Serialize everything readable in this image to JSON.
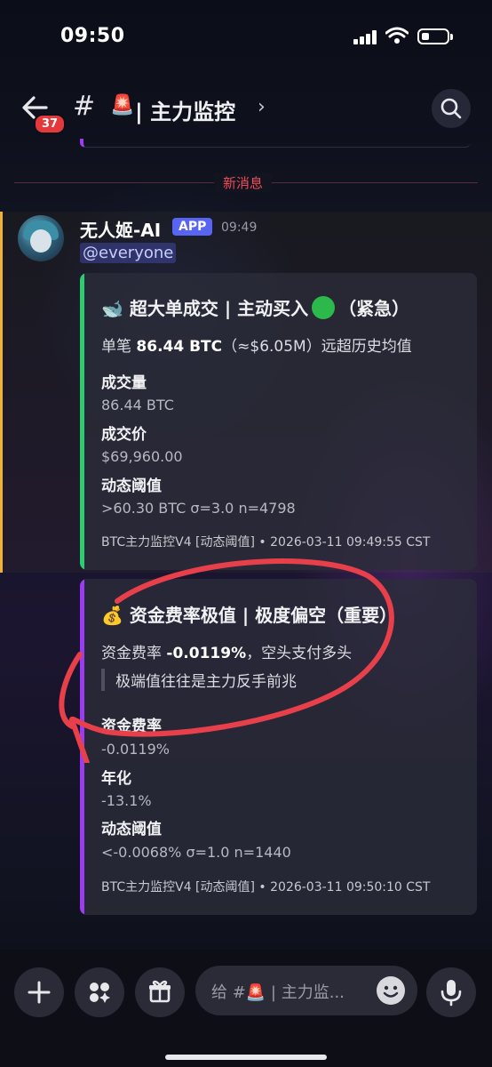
{
  "status_bar": {
    "time": "09:50"
  },
  "header": {
    "back_badge": "37",
    "hash": "#",
    "channel_emoji": "🚨",
    "channel_name": "| 主力监控",
    "chevron": "›",
    "icons": [
      "back-arrow-icon",
      "search-icon"
    ]
  },
  "divider": {
    "label": "新消息"
  },
  "message": {
    "author": "无人姬-AI",
    "app_tag": "APP",
    "time": "09:49",
    "mention": "@everyone"
  },
  "embeds": [
    {
      "accent": "#2ecc71",
      "title_pre": "🐋 超大单成交 | 主动买入",
      "title_post": "（紧急）",
      "desc_pre": "单笔 ",
      "desc_bold": "86.44 BTC",
      "desc_post": "（≈$6.05M）远超历史均值",
      "fields": [
        {
          "name": "成交量",
          "value": "86.44 BTC"
        },
        {
          "name": "成交价",
          "value": "$69,960.00"
        },
        {
          "name": "动态阈值",
          "value": ">60.30 BTC σ=3.0 n=4798"
        }
      ],
      "footer": "BTC主力监控V4 [动态阈值] • 2026-03-11 09:49:55 CST"
    },
    {
      "accent": "#9b3cf0",
      "title": "💰 资金费率极值 | 极度偏空（重要）",
      "desc_pre": "资金费率 ",
      "desc_bold": "-0.0119%",
      "desc_post": "，空头支付多头",
      "quote": "极端值往往是主力反手前兆",
      "fields": [
        {
          "name": "资金费率",
          "value": "-0.0119%"
        },
        {
          "name": "年化",
          "value": "-13.1%"
        },
        {
          "name": "动态阈值",
          "value": "<-0.0068% σ=1.0 n=1440"
        }
      ],
      "footer": "BTC主力监控V4 [动态阈值] • 2026-03-11 09:50:10 CST"
    }
  ],
  "composer": {
    "placeholder": "给 #🚨 | 主力监...",
    "icons": [
      "plus-icon",
      "apps-icon",
      "gift-icon",
      "emoji-icon",
      "microphone-icon"
    ]
  },
  "colors": {
    "new_divider": "#ef4a58",
    "app_tag": "#5865f2",
    "badge": "#e5383b",
    "annotation": "#e8404a"
  }
}
